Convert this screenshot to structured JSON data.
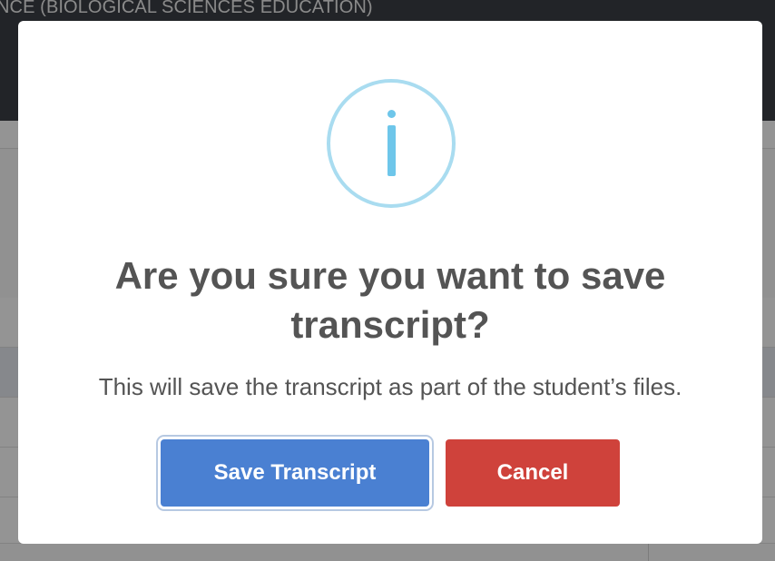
{
  "background": {
    "header_title": "NCE (BIOLOGICAL SCIENCES EDUCATION)"
  },
  "dialog": {
    "icon": "info-icon",
    "title": "Are you sure you want to save transcript?",
    "message": "This will save the transcript as part of the student’s files.",
    "confirm_label": "Save Transcript",
    "cancel_label": "Cancel"
  },
  "colors": {
    "confirm_button": "#4a80d2",
    "cancel_button": "#cf423b",
    "info_icon": "#6ec6ea",
    "info_ring": "#a9dcf0"
  }
}
